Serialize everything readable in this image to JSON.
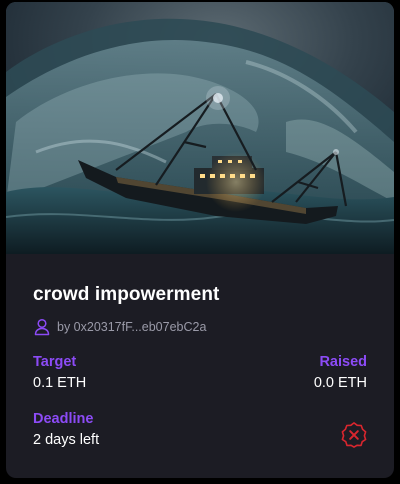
{
  "card": {
    "title": "crowd impowerment",
    "owner": "by 0x20317fF...eb07ebC2a",
    "image_alt": "ship in a stormy sea",
    "target_label": "Target",
    "target_value": "0.1 ETH",
    "raised_label": "Raised",
    "raised_value": "0.0 ETH",
    "deadline_label": "Deadline",
    "deadline_value": "2 days left",
    "status_icon": "close-circle-icon"
  },
  "colors": {
    "card_bg": "#1c1c24",
    "accent": "#8c4bf6",
    "status_red": "#d9262e"
  }
}
